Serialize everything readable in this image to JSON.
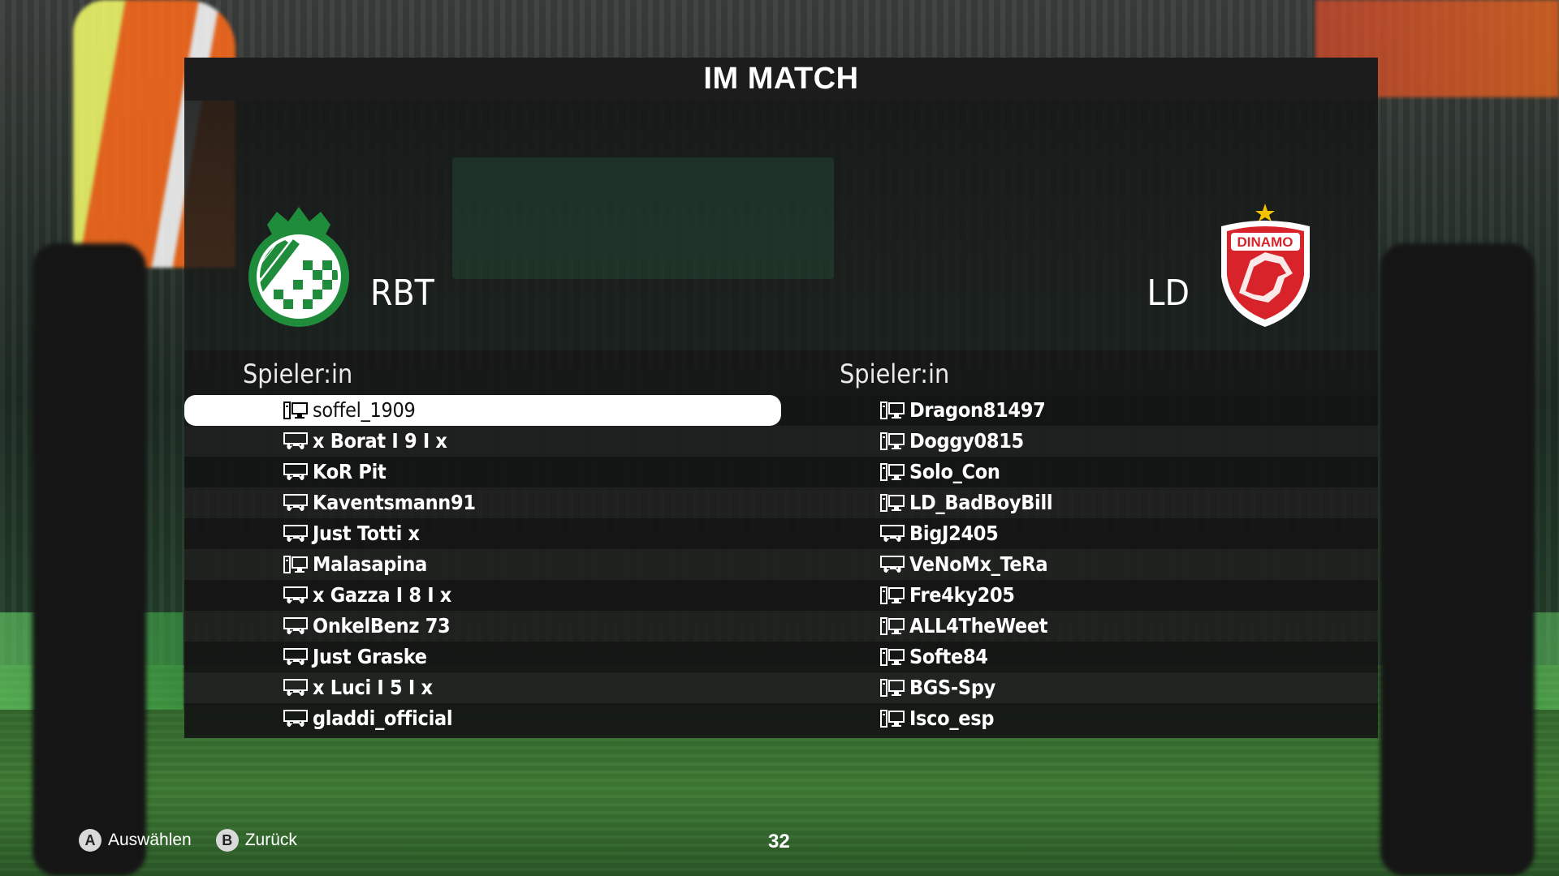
{
  "title": "IM MATCH",
  "home": {
    "name": "RBT",
    "crest": "rbt-crest-green-checkered"
  },
  "away": {
    "name": "LD",
    "crest": "dinamo-crest-red-wolf"
  },
  "home_header": "Spieler:in",
  "away_header": "Spieler:in",
  "home_players": [
    {
      "name": "soffel_1909",
      "platform": "pc-icon"
    },
    {
      "name": "x Borat I 9 I x",
      "platform": "console-icon"
    },
    {
      "name": "KoR Pit",
      "platform": "console-icon"
    },
    {
      "name": "Kaventsmann91",
      "platform": "console-icon"
    },
    {
      "name": "Just Totti x",
      "platform": "console-icon"
    },
    {
      "name": "Malasapina",
      "platform": "pc-icon"
    },
    {
      "name": "x Gazza I 8 I x",
      "platform": "console-icon"
    },
    {
      "name": "OnkelBenz 73",
      "platform": "console-icon"
    },
    {
      "name": "Just Graske",
      "platform": "console-icon"
    },
    {
      "name": "x Luci I 5 I x",
      "platform": "console-icon"
    },
    {
      "name": "gladdi_official",
      "platform": "console-icon"
    }
  ],
  "away_players": [
    {
      "name": "Dragon81497",
      "platform": "pc-icon"
    },
    {
      "name": "Doggy0815",
      "platform": "pc-icon"
    },
    {
      "name": "Solo_Con",
      "platform": "pc-icon"
    },
    {
      "name": "LD_BadBoyBill",
      "platform": "pc-icon"
    },
    {
      "name": "BigJ2405",
      "platform": "console-icon"
    },
    {
      "name": "VeNoMx_TeRa",
      "platform": "console-icon"
    },
    {
      "name": "Fre4ky205",
      "platform": "pc-icon"
    },
    {
      "name": "ALL4TheWeet",
      "platform": "pc-icon"
    },
    {
      "name": "Softe84",
      "platform": "pc-icon"
    },
    {
      "name": "BGS-Spy",
      "platform": "pc-icon"
    },
    {
      "name": "Isco_esp",
      "platform": "pc-icon"
    }
  ],
  "footer": {
    "select_key": "A",
    "select_label": "Auswählen",
    "back_key": "B",
    "back_label": "Zurück"
  },
  "counter": "32",
  "colors": {
    "home_green": "#1f8c3c",
    "away_red": "#d8232a",
    "selected_row": "#ffffff"
  }
}
